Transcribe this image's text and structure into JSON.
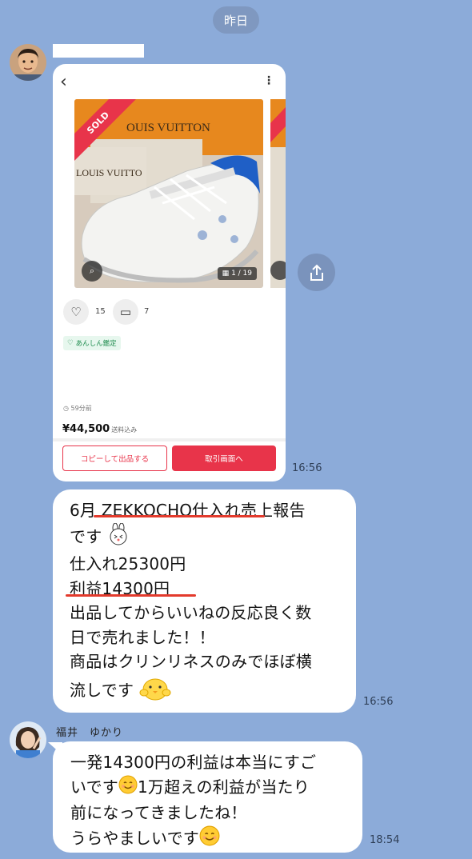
{
  "chat": {
    "date_label": "昨日",
    "sender_name": "福井　ゆかり"
  },
  "screenshot": {
    "brand_text": "LOUIS VUITTON",
    "sold_label": "SOLD",
    "image_counter": "1 / 19",
    "likes": "15",
    "comments": "7",
    "badge": "あんしん鑑定",
    "elapsed": "59分前",
    "price": "¥44,500",
    "shipping": "送料込み",
    "copy_button": "コピーして出品する",
    "trade_button": "取引画面へ",
    "time": "16:56"
  },
  "message1": {
    "l1a": "6月 ",
    "l1b": "ZEKKOCHO仕入れ",
    "l1c": "売上報告",
    "l2": "です",
    "l3": "仕入れ25300円",
    "l4": "利益14300円",
    "l5": "出品してからいいねの反応良く数",
    "l6": "日で売れました！！",
    "l7": "商品はクリンリネスのみでほぼ横",
    "l8": "流しです",
    "time": "16:56"
  },
  "message2": {
    "l1": "一発14300円の利益は本当にすご",
    "l2a": "いです",
    "l2b": "1万超えの利益が当たり",
    "l3": "前になってきましたね！",
    "l4": "うらやましいです",
    "time": "18:54"
  },
  "colors": {
    "background": "#8cabd9",
    "bubble": "#ffffff",
    "accent_red": "#e8344a",
    "underline": "#e33a2c"
  }
}
